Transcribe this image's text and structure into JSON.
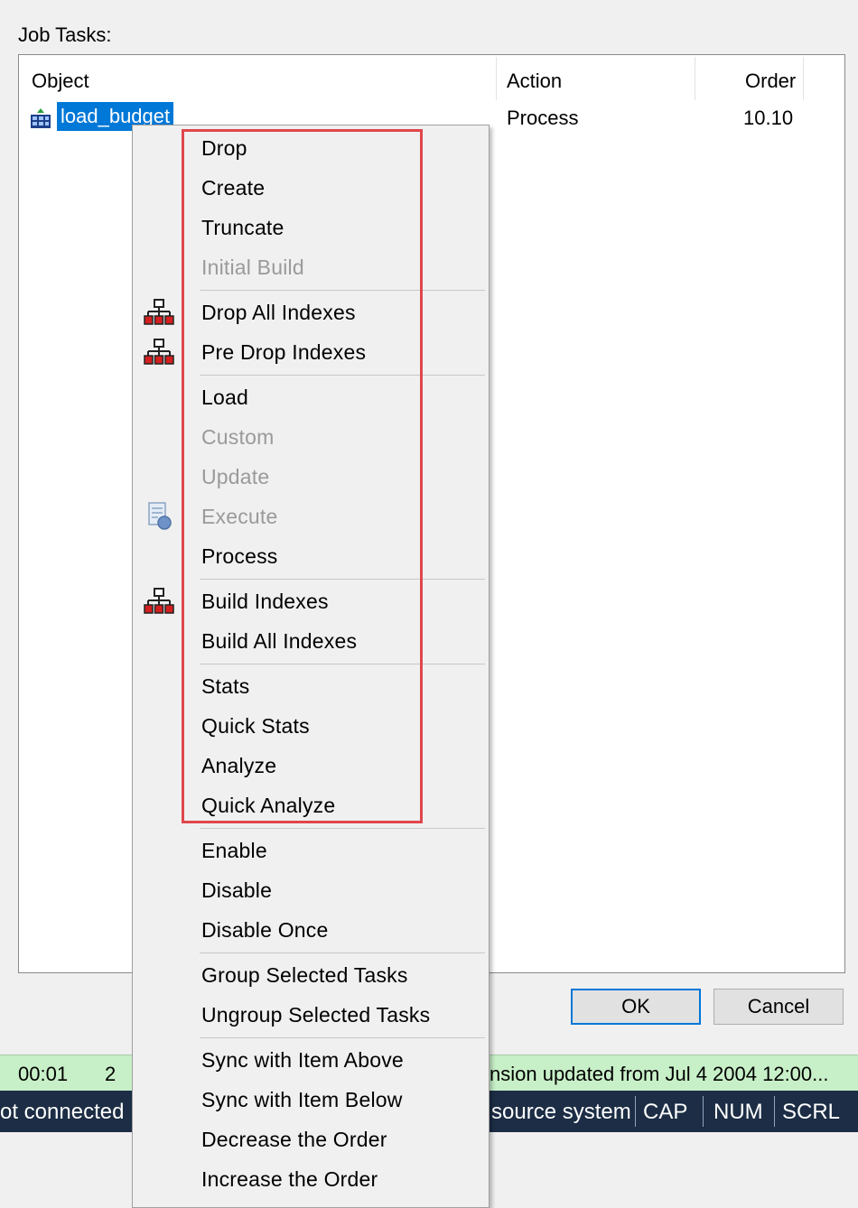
{
  "job_tasks": {
    "label": "Job Tasks:",
    "columns": [
      "Object",
      "Action",
      "Order"
    ],
    "rows": [
      {
        "object": "load_budget",
        "action": "Process",
        "order": "10.10"
      }
    ]
  },
  "buttons": {
    "ok": "OK",
    "cancel": "Cancel"
  },
  "status": {
    "row1": {
      "time": "00:01",
      "count": "2",
      "message": "nsion updated from Jul  4 2004 12:00..."
    },
    "row2": {
      "connection": "ot connected",
      "source": "source system",
      "cap": "CAP",
      "num": "NUM",
      "scrl": "SCRL"
    }
  },
  "menu": {
    "items": [
      {
        "label": "Drop",
        "disabled": false,
        "icon": ""
      },
      {
        "label": "Create",
        "disabled": false,
        "icon": ""
      },
      {
        "label": "Truncate",
        "disabled": false,
        "icon": ""
      },
      {
        "label": "Initial Build",
        "disabled": true,
        "icon": ""
      },
      {
        "label": "Drop All Indexes",
        "disabled": false,
        "icon": "index-hierarchy-icon"
      },
      {
        "label": "Pre Drop Indexes",
        "disabled": false,
        "icon": "index-hierarchy-icon"
      },
      {
        "label": "Load",
        "disabled": false,
        "icon": ""
      },
      {
        "label": "Custom",
        "disabled": true,
        "icon": ""
      },
      {
        "label": "Update",
        "disabled": true,
        "icon": ""
      },
      {
        "label": "Execute",
        "disabled": true,
        "icon": "execute-document-icon"
      },
      {
        "label": "Process",
        "disabled": false,
        "icon": ""
      },
      {
        "label": "Build Indexes",
        "disabled": false,
        "icon": "index-hierarchy-icon"
      },
      {
        "label": "Build All Indexes",
        "disabled": false,
        "icon": ""
      },
      {
        "label": "Stats",
        "disabled": false,
        "icon": ""
      },
      {
        "label": "Quick Stats",
        "disabled": false,
        "icon": ""
      },
      {
        "label": "Analyze",
        "disabled": false,
        "icon": ""
      },
      {
        "label": "Quick Analyze",
        "disabled": false,
        "icon": ""
      },
      {
        "label": "Enable",
        "disabled": false,
        "icon": ""
      },
      {
        "label": "Disable",
        "disabled": false,
        "icon": ""
      },
      {
        "label": "Disable Once",
        "disabled": false,
        "icon": ""
      },
      {
        "label": "Group Selected Tasks",
        "disabled": false,
        "icon": ""
      },
      {
        "label": "Ungroup Selected Tasks",
        "disabled": false,
        "icon": ""
      },
      {
        "label": "Sync with Item Above",
        "disabled": false,
        "icon": ""
      },
      {
        "label": "Sync with Item Below",
        "disabled": false,
        "icon": ""
      },
      {
        "label": "Decrease the Order",
        "disabled": false,
        "icon": ""
      },
      {
        "label": "Increase the Order",
        "disabled": false,
        "icon": ""
      }
    ]
  },
  "colors": {
    "selection": "#0078d7",
    "highlight_border": "#e0474c",
    "status_green": "#c8f0c8",
    "status_navy": "#1c2d45",
    "disabled_text": "#9a9a9a"
  }
}
